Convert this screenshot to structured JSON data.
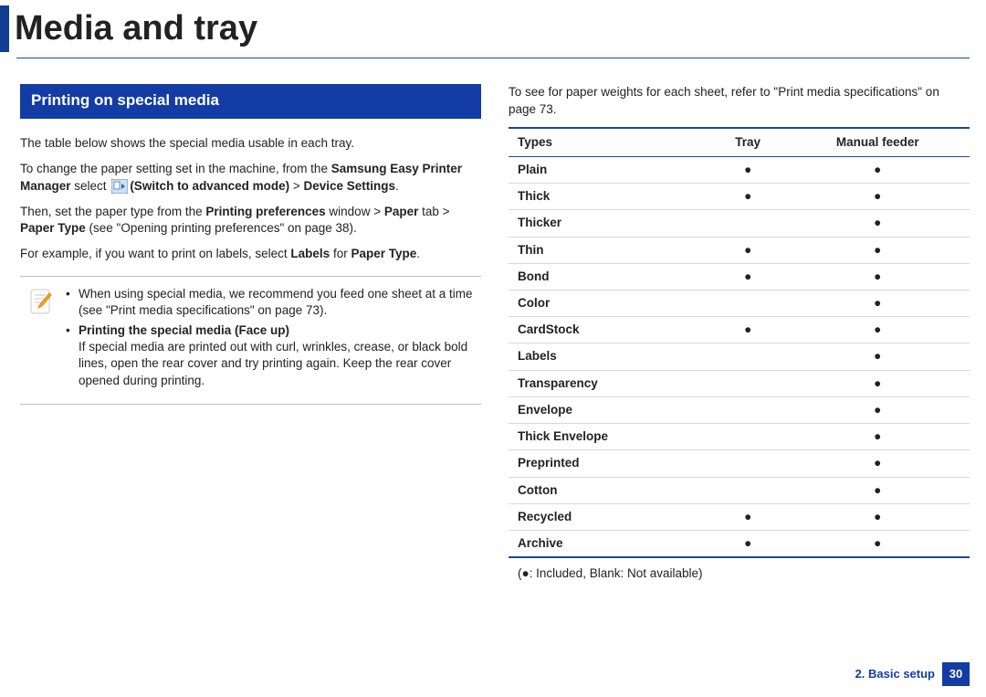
{
  "page_title": "Media and tray",
  "left": {
    "heading": "Printing on special media",
    "p1": "The table below shows the special media usable in each tray.",
    "p2_pre": "To change the paper setting set in the machine, from the ",
    "p2_bold1": "Samsung Easy Printer Manager",
    "p2_mid": " select ",
    "p2_bold2": "(Switch to advanced mode)",
    "p2_gt": " > ",
    "p2_bold3": "Device Settings",
    "p2_end": ".",
    "p3_pre": "Then, set the paper type from the ",
    "p3_b1": "Printing preferences",
    "p3_mid1": " window > ",
    "p3_b2": "Paper",
    "p3_mid2": " tab > ",
    "p3_b3": "Paper Type",
    "p3_end": " (see \"Opening printing preferences\" on page 38).",
    "p4_pre": "For example, if you want to print on labels, select ",
    "p4_b1": "Labels",
    "p4_mid": " for ",
    "p4_b2": "Paper Type",
    "p4_end": ".",
    "note": {
      "b1": "When using special media, we recommend you feed one sheet at a time (see \"Print media specifications\" on page 73).",
      "b2_title": "Printing the special media (Face up)",
      "b2_body": "If special media are printed out with curl, wrinkles, crease, or black bold lines, open the rear cover and try printing again. Keep the rear cover opened during printing."
    }
  },
  "right": {
    "intro": "To see for paper weights for each sheet, refer to \"Print media specifications\" on page 73.",
    "headers": [
      "Types",
      "Tray",
      "Manual feeder"
    ],
    "rows": [
      {
        "type": "Plain",
        "tray": "●",
        "manual": "●"
      },
      {
        "type": "Thick",
        "tray": "●",
        "manual": "●"
      },
      {
        "type": "Thicker",
        "tray": "",
        "manual": "●"
      },
      {
        "type": "Thin",
        "tray": "●",
        "manual": "●"
      },
      {
        "type": "Bond",
        "tray": "●",
        "manual": "●"
      },
      {
        "type": "Color",
        "tray": "",
        "manual": "●"
      },
      {
        "type": "CardStock",
        "tray": "●",
        "manual": "●"
      },
      {
        "type": "Labels",
        "tray": "",
        "manual": "●"
      },
      {
        "type": "Transparency",
        "tray": "",
        "manual": "●"
      },
      {
        "type": "Envelope",
        "tray": "",
        "manual": "●"
      },
      {
        "type": "Thick Envelope",
        "tray": "",
        "manual": "●"
      },
      {
        "type": "Preprinted",
        "tray": "",
        "manual": "●"
      },
      {
        "type": "Cotton",
        "tray": "",
        "manual": "●"
      },
      {
        "type": "Recycled",
        "tray": "●",
        "manual": "●"
      },
      {
        "type": "Archive",
        "tray": "●",
        "manual": "●"
      }
    ],
    "legend": "(●: Included, Blank: Not available)"
  },
  "footer": {
    "section": "2. Basic setup",
    "page": "30"
  }
}
